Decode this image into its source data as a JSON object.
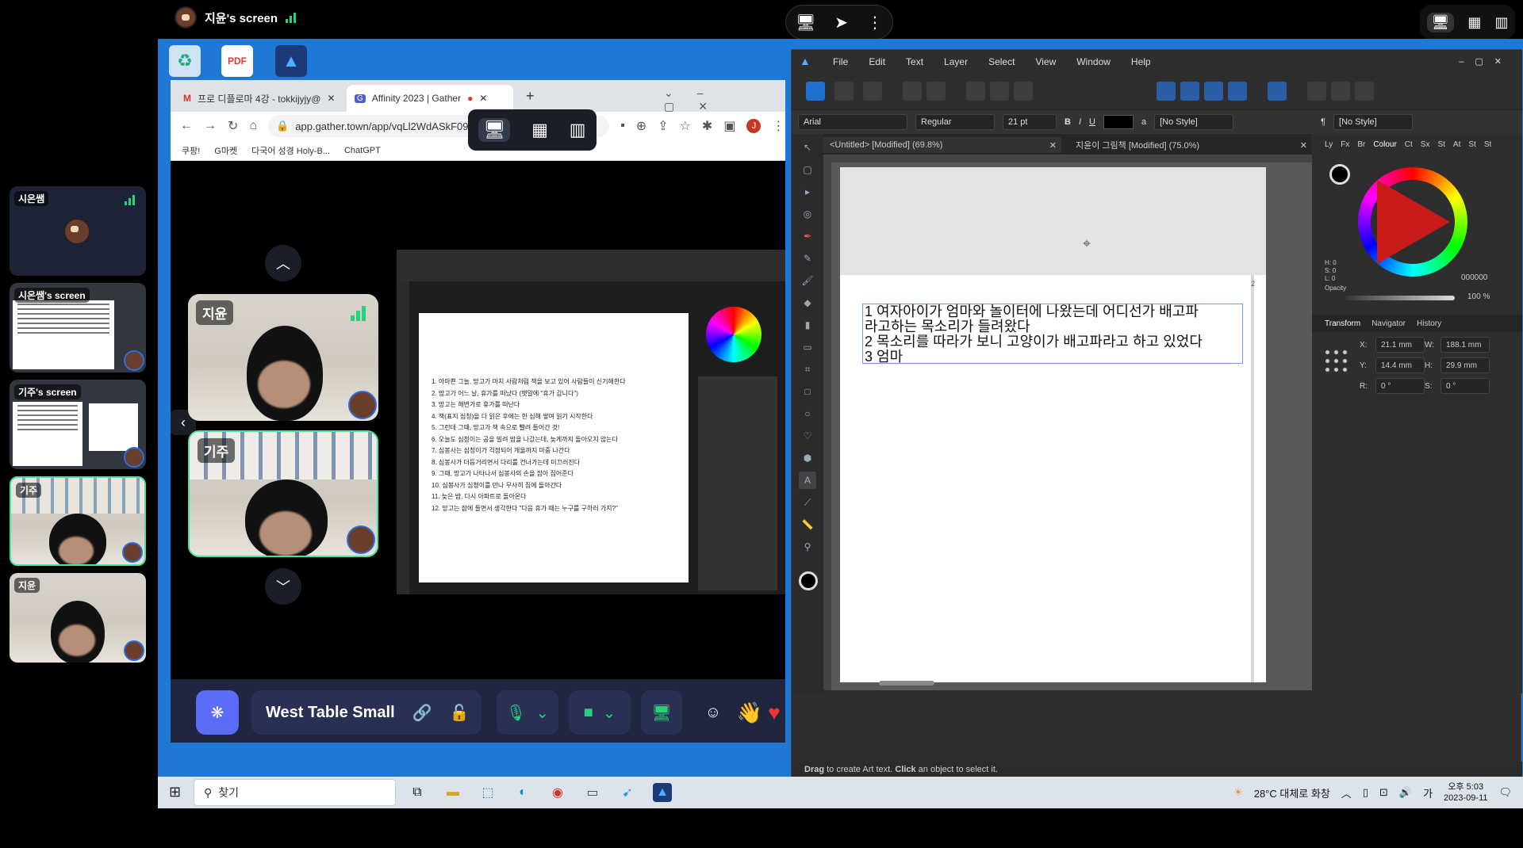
{
  "topbar": {
    "presenter": "지윤's screen"
  },
  "sidebar": {
    "tiles": [
      {
        "name": "시온쌤"
      },
      {
        "name": "시온쌤's screen"
      },
      {
        "name": "기주's screen"
      },
      {
        "name": "기주"
      },
      {
        "name": "지윤"
      }
    ]
  },
  "chrome": {
    "tab1": "프로 디플로마 4강 - tokkijyjy@",
    "tab2": "Affinity 2023 | Gather",
    "url": "app.gather.town/app/vqLl2WdASkF0923P/Affinity%202023",
    "bookmarks": [
      "쿠팡!",
      "G마켓",
      "다국어 성경 Holy-B...",
      "ChatGPT"
    ],
    "profile": "J"
  },
  "gather": {
    "videos": [
      {
        "name": "지윤"
      },
      {
        "name": "기주"
      }
    ],
    "room_name": "West Table Small",
    "shared_doc_lines": [
      "1. 아마쁜 그늘, 망고가 마치 사람처럼 책을 보고 있어 사람들이 신기해한다",
      "2. 망고가 어느 날, 휴가를 떠났다 (팻말에 \"휴가 갑니다\")",
      "3. 망고는 해변가로 휴가를 떠난다",
      "4. 책(표지 심청)을 다 읽은 후에는 한 심해 쌓여 읽기 시작한다",
      "5. 그런데 그때, 망고가 책 속으로 빨려 들어간 것!",
      "6. 오늘도 심청이는 공을 빌려 맘을 나갔는데, 늦게까지 돌아오지 않는다",
      "7. 심봉사는 심청이가 걱정되어 개울까지 마중 나간다",
      "8. 심봉사가 더듬거리면서 다리를 건너가는데 미끄러진다",
      "9. 그때, 망고가 나타나서 심봉사의 손을 잡아 집어준다",
      "10. 심봉사가 심청이를 만나 무사히 집에 돌아간다",
      "11. 늦은 밤, 다시 아파트로 돌아온다",
      "12. 망고는 잠에 들면서 생각한다 \"다음 휴가 때는 누구를 구하러 가지?\""
    ]
  },
  "affinity": {
    "menu": [
      "File",
      "Edit",
      "Text",
      "Layer",
      "Select",
      "View",
      "Window",
      "Help"
    ],
    "font": "Arial",
    "weight": "Regular",
    "size": "21 pt",
    "no_style_1": "[No Style]",
    "no_style_2": "[No Style]",
    "doc_tab1": "<Untitled> [Modified] (69.8%)",
    "doc_tab2": "지윤이 그림책 [Modified] (75.0%)",
    "page_number": "2",
    "text_lines": [
      "1 여자아이가 엄마와 놀이터에 나왔는데 어디선가 배고파",
      "라고하는 목소리가 들려왔다",
      "2 목소리를 따라가 보니 고양이가 배고파라고 하고 있었다",
      "3 엄마"
    ],
    "panel_tabs": [
      "Ly",
      "Fx",
      "Br",
      "Colour",
      "Ct",
      "Sx",
      "St",
      "At",
      "St",
      "St"
    ],
    "hex": "000000",
    "opacity_label": "Opacity",
    "opacity_value": "100 %",
    "hsl": [
      "H: 0",
      "S: 0",
      "L: 0"
    ],
    "transform_tabs": [
      "Transform",
      "Navigator",
      "History"
    ],
    "transform": {
      "x": "21.1 mm",
      "y": "14.4 mm",
      "w": "188.1 mm",
      "h": "29.9 mm",
      "r": "0 °",
      "s": "0 °"
    },
    "status_bold1": "Drag",
    "status_text1": " to create Art text. ",
    "status_bold2": "Click",
    "status_text2": " an object to select it."
  },
  "taskbar": {
    "search": "찾기",
    "weather": "28°C 대체로 화창",
    "time": "오후 5:03",
    "date": "2023-09-11",
    "ime": "가"
  },
  "colors": {
    "desktop": "#1f78d4",
    "gather_accent": "#5c6cf7",
    "signal_green": "#27d17c",
    "selected_border": "#46e4a0"
  }
}
